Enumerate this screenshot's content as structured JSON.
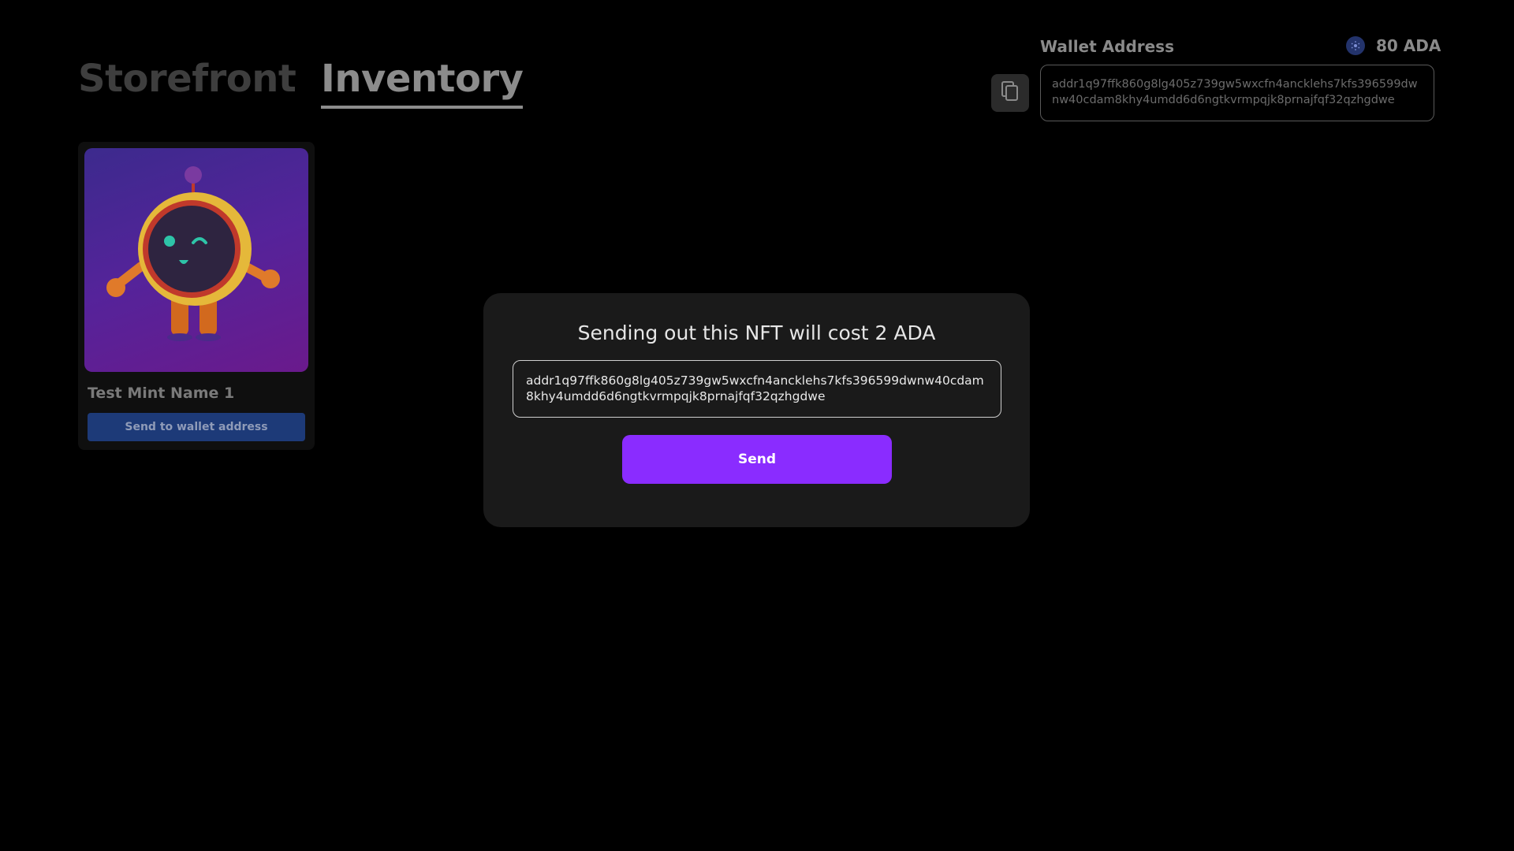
{
  "tabs": [
    {
      "label": "Storefront",
      "active": false
    },
    {
      "label": "Inventory",
      "active": true
    }
  ],
  "wallet": {
    "label": "Wallet Address",
    "balance": "80 ADA",
    "address": "addr1q97ffk860g8lg405z739gw5wxcfn4ancklehs7kfs396599dwnw40cdam8khy4umdd6d6ngtkvrmpqjk8prnajfqf32qzhgdwe",
    "copy_icon": "copy-icon",
    "currency_icon": "cardano-icon"
  },
  "nft": {
    "name": "Test Mint Name 1",
    "send_label": "Send to wallet address",
    "image_icon": "robot-mascot-image"
  },
  "modal": {
    "title": "Sending out this NFT will cost 2 ADA",
    "address_value": "addr1q97ffk860g8lg405z739gw5wxcfn4ancklehs7kfs396599dwnw40cdam8khy4umdd6d6ngtkvrmpqjk8prnajfqf32qzhgdwe",
    "send_label": "Send"
  },
  "colors": {
    "background": "#000000",
    "modal_bg": "#1a1a1a",
    "accent_purple": "#8a2cff",
    "nft_button": "#1d3a78"
  }
}
